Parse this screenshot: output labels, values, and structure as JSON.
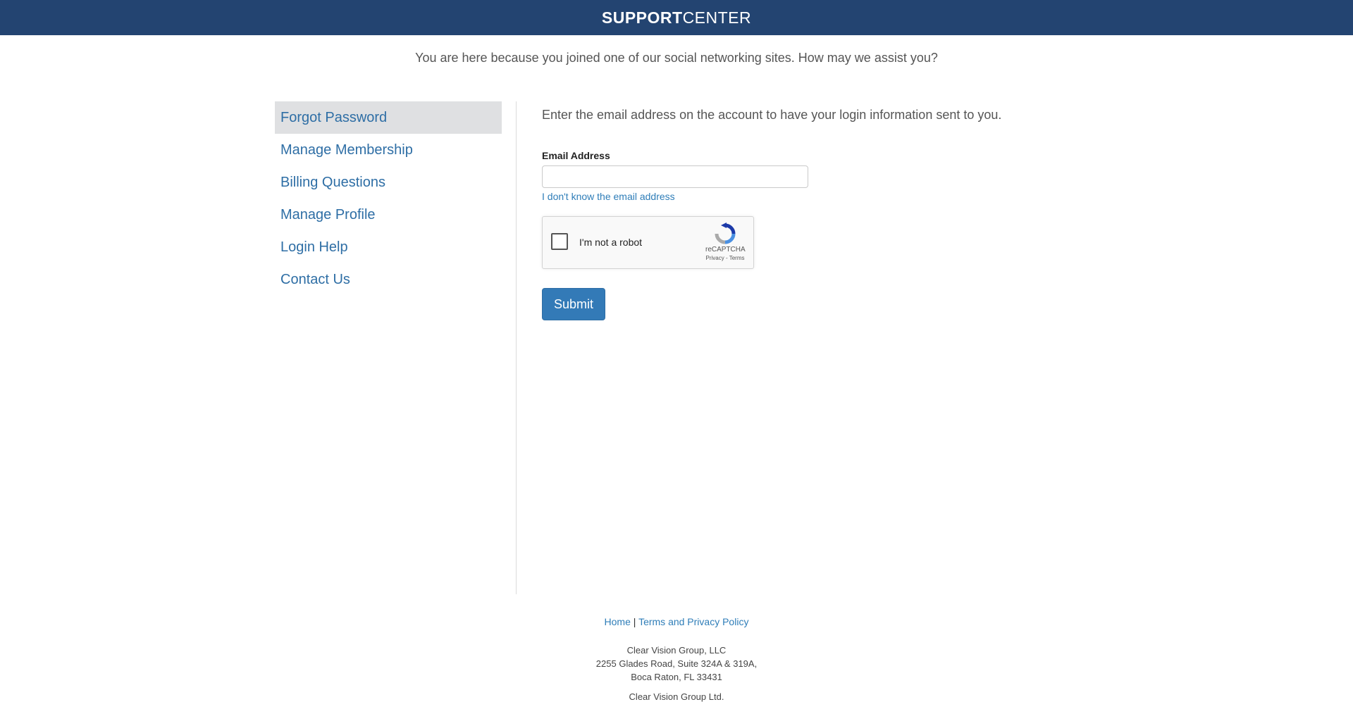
{
  "header": {
    "brand_bold": "SUPPORT",
    "brand_light": "CENTER",
    "bg_color": "#234471"
  },
  "intro": "You are here because you joined one of our social networking sites. How may we assist you?",
  "sidebar": {
    "items": [
      {
        "label": "Forgot Password",
        "active": true
      },
      {
        "label": "Manage Membership"
      },
      {
        "label": "Billing Questions"
      },
      {
        "label": "Manage Profile"
      },
      {
        "label": "Login Help"
      },
      {
        "label": "Contact Us"
      }
    ]
  },
  "main": {
    "instructions": "Enter the email address on the account to have your login information sent to you.",
    "email_label": "Email Address",
    "email_value": "",
    "unknown_link": "I don't know the email address",
    "captcha": {
      "label": "I'm not a robot",
      "brand": "reCAPTCHA",
      "privacy": "Privacy",
      "separator": "-",
      "terms": "Terms",
      "icon": "recaptcha-icon"
    },
    "submit_label": "Submit",
    "accent_color": "#337ab7"
  },
  "footer": {
    "home": "Home",
    "separator": "|",
    "terms": "Terms and Privacy Policy",
    "company1": "Clear Vision Group, LLC",
    "address1": "2255 Glades Road, Suite 324A & 319A,",
    "city1": "Boca Raton, FL 33431",
    "company2": "Clear Vision Group Ltd."
  }
}
